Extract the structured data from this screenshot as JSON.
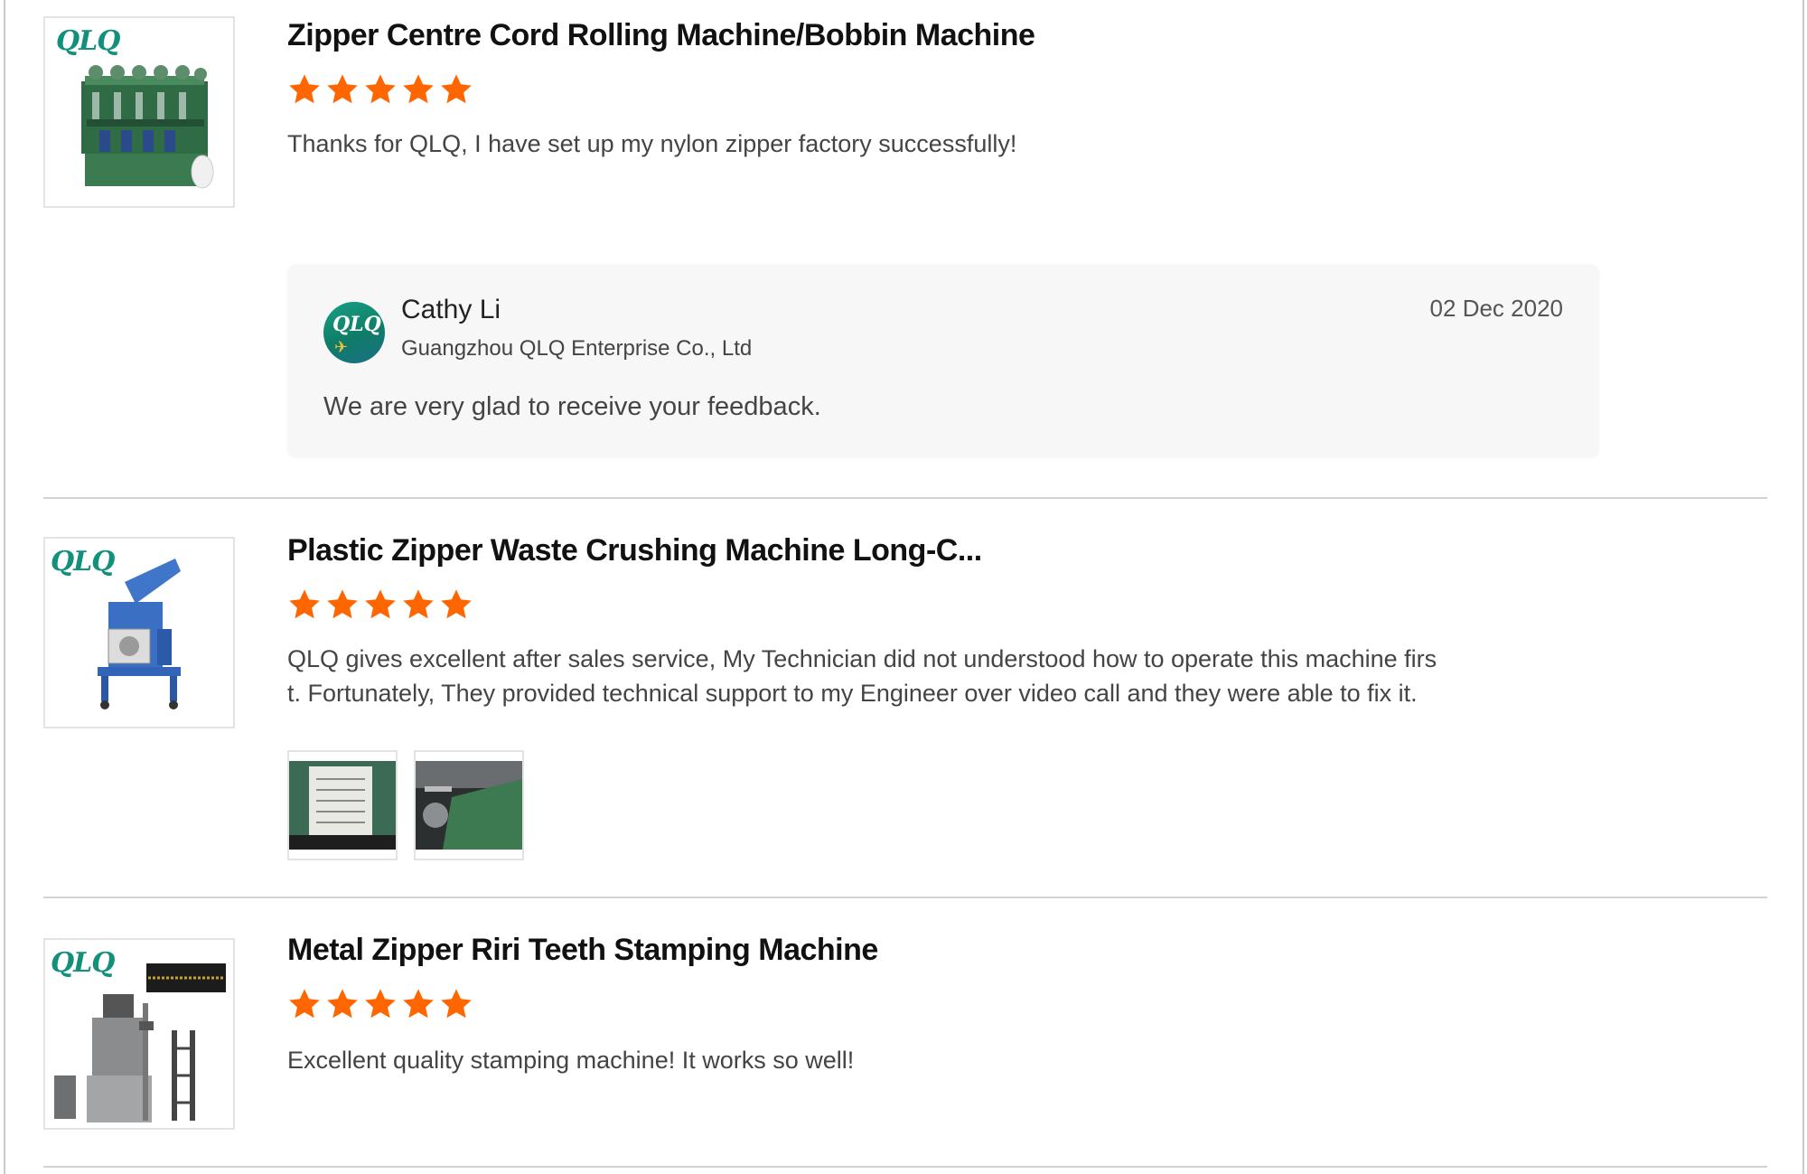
{
  "brand_logo_text": "QLQ",
  "reviews": [
    {
      "title": "Zipper Centre Cord Rolling Machine/Bobbin Machine",
      "rating": 5,
      "text": "Thanks for QLQ, I have set up my nylon zipper factory successfully!",
      "reply": {
        "name": "Cathy Li",
        "company": "Guangzhou QLQ Enterprise Co., Ltd",
        "date": "02 Dec 2020",
        "message": "We are very glad to receive your feedback."
      }
    },
    {
      "title": "Plastic Zipper Waste Crushing Machine Long-C...",
      "rating": 5,
      "text_line1": "QLQ gives excellent after sales service, My Technician did not understood how to operate this machine firs",
      "text_line2": "t. Fortunately, They provided technical support to my Engineer over video call and they were able to fix it.",
      "photos": [
        "nameplate photo",
        "machine detail photo"
      ]
    },
    {
      "title": "Metal Zipper Riri Teeth Stamping Machine",
      "rating": 5,
      "text": "Excellent quality stamping machine! It works so well!"
    }
  ],
  "colors": {
    "star": "#ff6600",
    "brand_green": "#11917b",
    "divider": "#d2d2d2",
    "reply_bg": "#f7f7f8"
  },
  "icons": [
    "star-icon",
    "brand-logo",
    "avatar"
  ]
}
